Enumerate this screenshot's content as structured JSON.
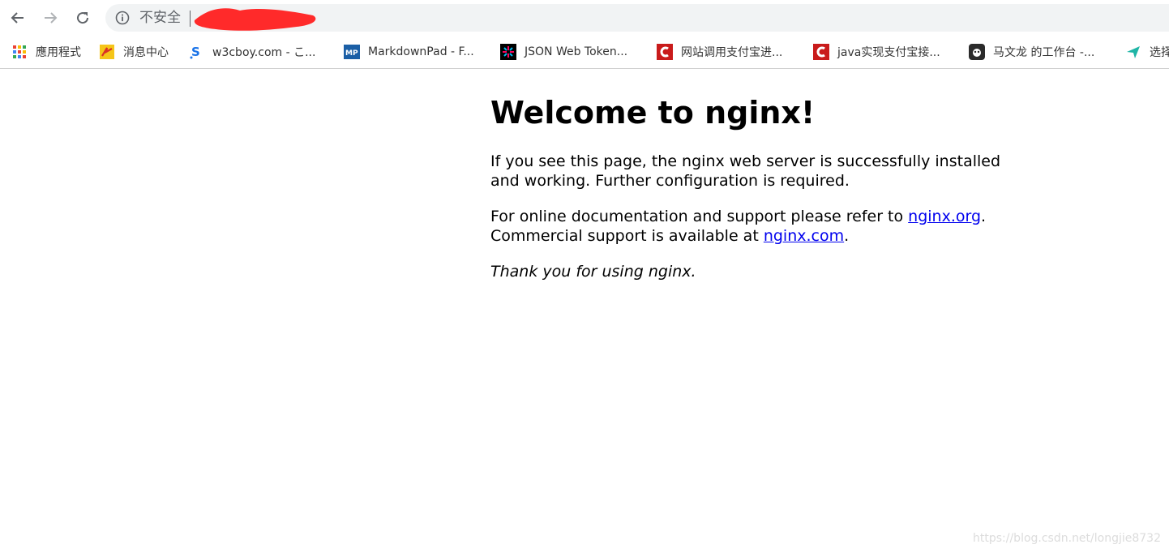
{
  "browser": {
    "security_label": "不安全"
  },
  "bookmarks": [
    {
      "label": "應用程式",
      "icon": "apps-grid-icon"
    },
    {
      "label": "消息中心",
      "icon": "message-center-icon"
    },
    {
      "label": "w3cboy.com - こ...",
      "icon": "w3cboy-icon"
    },
    {
      "label": "MarkdownPad - F...",
      "icon": "markdownpad-icon"
    },
    {
      "label": "JSON Web Token...",
      "icon": "jwt-icon"
    },
    {
      "label": "网站调用支付宝进...",
      "icon": "csdn-icon"
    },
    {
      "label": "java实现支付宝接...",
      "icon": "csdn-icon"
    },
    {
      "label": "马文龙 的工作台 -...",
      "icon": "workbench-icon"
    },
    {
      "label": "选择",
      "icon": "send-icon"
    }
  ],
  "page": {
    "title": "Welcome to nginx!",
    "p1": "If you see this page, the nginx web server is successfully installed and working. Further configuration is required.",
    "p2_prefix": "For online documentation and support please refer to ",
    "link_org": "nginx.org",
    "p2_mid": ".",
    "p2_line2_prefix": "Commercial support is available at ",
    "link_com": "nginx.com",
    "p2_suffix": ".",
    "thanks": "Thank you for using nginx."
  },
  "watermark": "https://blog.csdn.net/longjie8732",
  "colors": {
    "link": "#0000ee",
    "omnibox_bg": "#f1f3f4",
    "redaction": "#ff2a2a"
  }
}
